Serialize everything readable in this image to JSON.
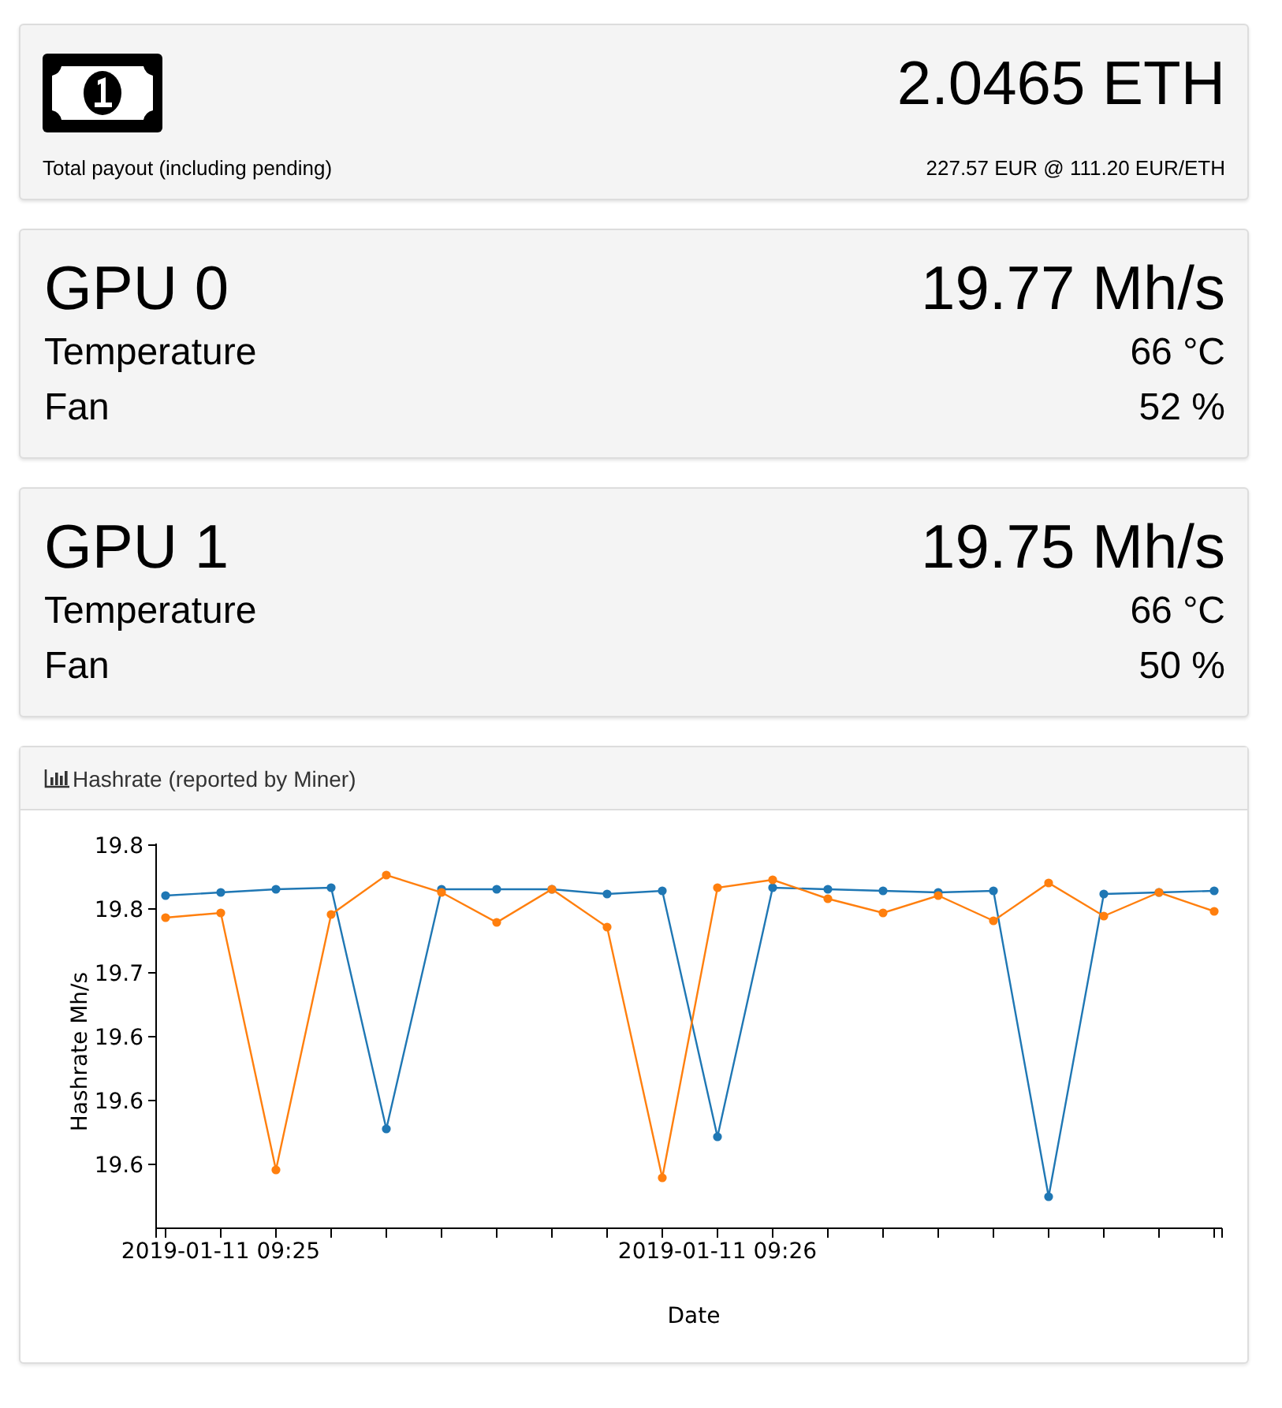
{
  "payout": {
    "amount": "2.0465 ETH",
    "label": "Total payout (including pending)",
    "conversion": "227.57 EUR @ 111.20 EUR/ETH"
  },
  "gpus": [
    {
      "name": "GPU 0",
      "hashrate": "19.77 Mh/s",
      "rows": [
        {
          "label": "Temperature",
          "value": "66 °C"
        },
        {
          "label": "Fan",
          "value": "52 %"
        }
      ]
    },
    {
      "name": "GPU 1",
      "hashrate": "19.75 Mh/s",
      "rows": [
        {
          "label": "Temperature",
          "value": "66 °C"
        },
        {
          "label": "Fan",
          "value": "50 %"
        }
      ]
    }
  ],
  "hashrate_panel": {
    "title": "Hashrate (reported by Miner)",
    "xlabel": "Date",
    "ylabel": "Hashrate Mh/s",
    "y_tick_labels": [
      "19.8",
      "19.8",
      "19.7",
      "19.6",
      "19.6",
      "19.6"
    ],
    "x_tick_labels": [
      "2019-01-11 09:25",
      "2019-01-11 09:26"
    ]
  }
}
